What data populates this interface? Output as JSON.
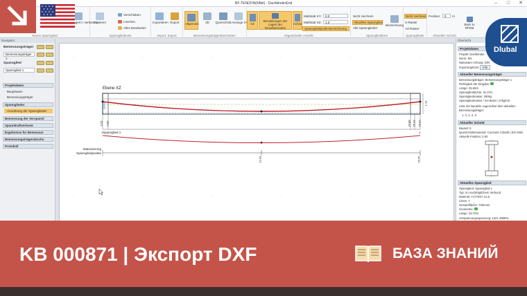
{
  "window": {
    "title": "RF-TENDON(64bit) - DachbinderEnd"
  },
  "ribbon": {
    "groups": [
      {
        "label": "Neues Spannglied"
      },
      {
        "label": "Spanngliedtools"
      },
      {
        "label": "Import, Export"
      },
      {
        "label": "Bemessungsträgerabschnitten"
      },
      {
        "label": "Abgewickelte Ansicht"
      },
      {
        "label": "Spanngliedform"
      },
      {
        "label": "Spannglieder"
      },
      {
        "label": "Aktuellen Schnitt"
      }
    ],
    "buttons": {
      "verlaengern": "Verlängern / verkürzen",
      "kopieren": "Kopieren",
      "verschieben": "Verschieben",
      "loeschen": "Löschen",
      "alles_bearbeiten": "Alles Bearbeiten",
      "importieren": "Importieren",
      "exportieren": "Export",
      "allgemein": "Allgemein",
      "view3d": "3D",
      "querschnitt": "Querschnitt",
      "anzeige_xy": "Anzeige XY",
      "xz": "XZ",
      "bemassungen": "Bemaßungen der Lagen der Resultierenden",
      "achse": "Achse",
      "massstab_xy": "Maßstab XY:",
      "massstab_xz": "Maßstab XZ:",
      "massstab_xy_val": "0.0",
      "massstab_xz_val": "1.0",
      "spannglied_bez": "Spanngliedpunkt-Bezeichnung",
      "nicht_zeichnen": "Nicht zeichnen",
      "aktuelles_spannglied": "Aktuelles Spannglied",
      "alle_spannglieder": "Alle Spannglieder",
      "bezeichnung": "Bezeichnung",
      "nicht_zeichnen2": "Nicht zeichnen",
      "x_raster": "X-Raster",
      "yz_raster": "YZ-Raster",
      "position": "Position:",
      "position_val": "0",
      "position_unit": "m",
      "back_to_rfem": "Back to RFEM"
    }
  },
  "navigator": {
    "header": "Navigator",
    "bemessungstraeger_label": "Bemessungsträger",
    "bemessungstraeger_val": "Bemessungsträger 1",
    "spannglied_label": "Spannglied",
    "spannglied_val": "Spannglied 1",
    "sections": [
      {
        "label": "Projektdaten"
      },
      {
        "label": "Spannglieder"
      },
      {
        "label": "Bemessung der Vorspannl"
      },
      {
        "label": "Spannkraftverluste"
      },
      {
        "label": "Ergebnisse für Bemessun"
      },
      {
        "label": "Bemessungsträgerabschn"
      },
      {
        "label": "Protokoll"
      }
    ],
    "items": [
      {
        "label": "Bauphasen"
      },
      {
        "label": "Bemessungsträger"
      },
      {
        "label": "Anordnung der Spannglieder"
      }
    ]
  },
  "canvas": {
    "view_label": "Ebene XZ",
    "spannglied_label": "Spannglied 1",
    "stationierung_label": "Stationierung",
    "spanngliedpunkte_label": "Spanngliedpunkte",
    "dim_labels": [
      "0.53",
      "0.80",
      "24.88",
      "25.33",
      "25.60"
    ],
    "dim_right": "1.10",
    "mid_label": "12.83",
    "end_label": "25.66",
    "point_labels": [
      "1",
      "2",
      "3"
    ]
  },
  "right_panel": {
    "header": "Übersicht",
    "projekt": {
      "title": "Projektdaten",
      "rows": [
        {
          "k": "Projekt:",
          "v": "Dachbinder"
        },
        {
          "k": "Norm:",
          "v": "EN"
        },
        {
          "k": "Nationaler Anhang:",
          "v": "DIN"
        },
        {
          "k": "Importergebnis:",
          "v": "Info"
        }
      ]
    },
    "bemessung": {
      "title": "Aktueller Bemessungsträger",
      "rows": [
        {
          "k": "Bemessungsträger:",
          "v": "Bemessungsträger 1"
        },
        {
          "k": "Richtigkeit der Eingabe:",
          "v": ""
        },
        {
          "k": "Länge:",
          "v": "25.66m"
        },
        {
          "k": "Spannglieddichte:",
          "v": "31.37m"
        },
        {
          "k": "Spanngliedmasse:",
          "v": "260kg"
        },
        {
          "k": "Spanngliedmasse / m3 Beton:",
          "v": "27kg/m3"
        },
        {
          "k": "Liste der Bauteile zugeordnet dem aktuellen",
          "v": ""
        },
        {
          "k": "Bemessungsträger:",
          "v": ""
        },
        {
          "k": "1, 4, 1, 2, 3",
          "v": ""
        }
      ]
    },
    "schnitt": {
      "title": "Aktueller Schnitt",
      "rows": [
        {
          "k": "Bauteil:",
          "v": "5"
        },
        {
          "k": "Querschnittsmaterial:",
          "v": "Concrete C35/45 | EN 1992"
        },
        {
          "k": "Aktuelle Position:",
          "v": "0.00"
        }
      ]
    },
    "spannglied": {
      "title": "Aktuelles Spannglied",
      "rows": [
        {
          "k": "Spannglied:",
          "v": "Spannglied 1"
        },
        {
          "k": "Typ:",
          "v": "Im nachträglichem Verbund"
        },
        {
          "k": "Material:",
          "v": "Y1770S7-12.5"
        },
        {
          "k": "Litzen:",
          "v": "7"
        },
        {
          "k": "Gesamtfläche:",
          "v": "700mm2"
        },
        {
          "k": "Geometrie:",
          "v": ""
        },
        {
          "k": "Länge:",
          "v": "25.70m"
        },
        {
          "k": "Vorspannungsspannung:",
          "v": "1321.39MPa"
        }
      ]
    }
  },
  "brand": {
    "logo_text": "Dlubal"
  },
  "banner": {
    "title": "KB 000871 | Экспорт DXF",
    "section": "БАЗА ЗНАНИЙ"
  },
  "colors": {
    "accent": "#c4544a",
    "brand": "#1d4f91",
    "highlight": "#f6c869"
  }
}
